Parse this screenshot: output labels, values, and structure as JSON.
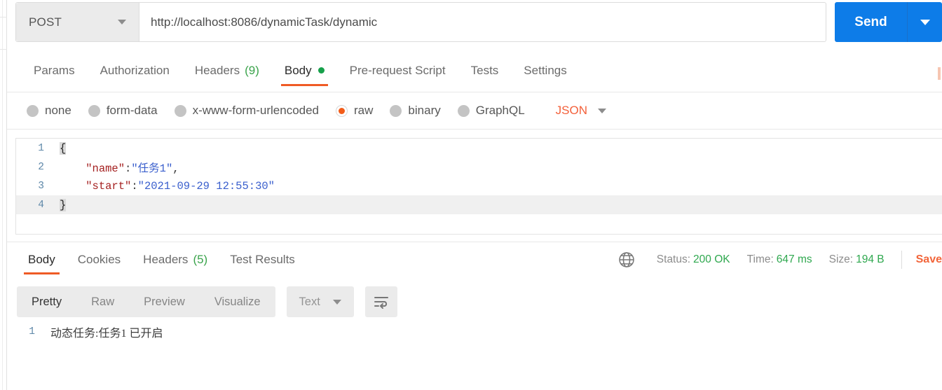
{
  "request": {
    "method": "POST",
    "url": "http://localhost:8086/dynamicTask/dynamic",
    "send_label": "Send",
    "tabs": [
      {
        "label": "Params",
        "count": "",
        "dot": false,
        "active": false
      },
      {
        "label": "Authorization",
        "count": "",
        "dot": false,
        "active": false
      },
      {
        "label": "Headers",
        "count": "(9)",
        "dot": false,
        "active": false
      },
      {
        "label": "Body",
        "count": "",
        "dot": true,
        "active": true
      },
      {
        "label": "Pre-request Script",
        "count": "",
        "dot": false,
        "active": false
      },
      {
        "label": "Tests",
        "count": "",
        "dot": false,
        "active": false
      },
      {
        "label": "Settings",
        "count": "",
        "dot": false,
        "active": false
      }
    ],
    "body_types": [
      {
        "label": "none",
        "selected": false
      },
      {
        "label": "form-data",
        "selected": false
      },
      {
        "label": "x-www-form-urlencoded",
        "selected": false
      },
      {
        "label": "raw",
        "selected": true
      },
      {
        "label": "binary",
        "selected": false
      },
      {
        "label": "GraphQL",
        "selected": false
      }
    ],
    "raw_format": "JSON",
    "editor": {
      "lines": [
        {
          "num": "1",
          "brace": "{",
          "key": "",
          "colon": "",
          "value": "",
          "tail": ""
        },
        {
          "num": "2",
          "brace": "",
          "key": "\"name\"",
          "colon": ":",
          "value": "\"任务1\"",
          "tail": ","
        },
        {
          "num": "3",
          "brace": "",
          "key": "\"start\"",
          "colon": ":",
          "value": "\"2021-09-29 12:55:30\"",
          "tail": ""
        },
        {
          "num": "4",
          "brace": "}",
          "key": "",
          "colon": "",
          "value": "",
          "tail": ""
        }
      ]
    }
  },
  "response": {
    "tabs": [
      {
        "label": "Body",
        "count": "",
        "active": true
      },
      {
        "label": "Cookies",
        "count": "",
        "active": false
      },
      {
        "label": "Headers",
        "count": "(5)",
        "active": false
      },
      {
        "label": "Test Results",
        "count": "",
        "active": false
      }
    ],
    "status_label": "Status:",
    "status_value": "200 OK",
    "time_label": "Time:",
    "time_value": "647 ms",
    "size_label": "Size:",
    "size_value": "194 B",
    "save_label": "Save",
    "view_modes": [
      {
        "label": "Pretty",
        "active": true
      },
      {
        "label": "Raw",
        "active": false
      },
      {
        "label": "Preview",
        "active": false
      },
      {
        "label": "Visualize",
        "active": false
      }
    ],
    "format": "Text",
    "body_lines": [
      {
        "num": "1",
        "text": "动态任务:任务1 已开启"
      }
    ]
  },
  "colors": {
    "accent_orange": "#ef5b25",
    "send_blue": "#0d7ce8",
    "success_green": "#2fa84f",
    "json_orange": "#f3603a"
  }
}
